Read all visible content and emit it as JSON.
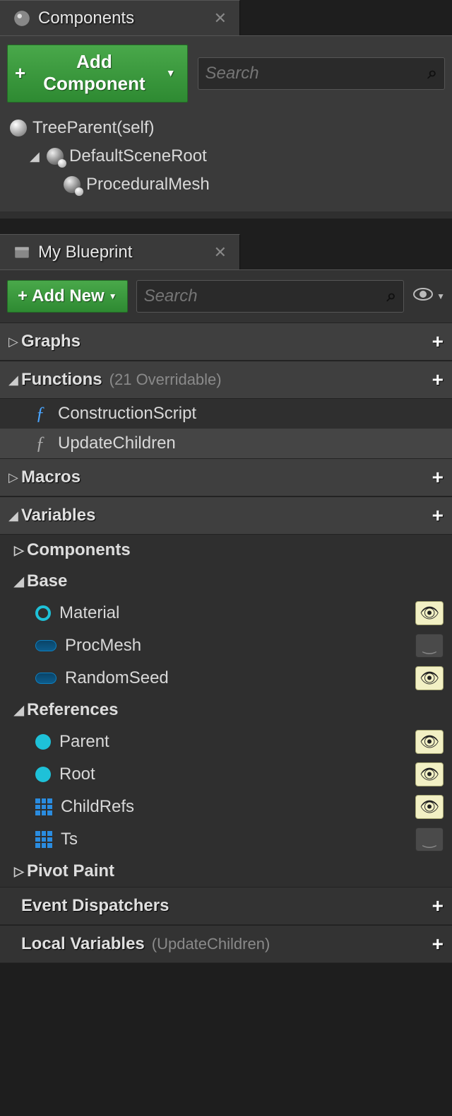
{
  "componentsPanel": {
    "title": "Components",
    "addLabel": "Add Component",
    "searchPlaceholder": "Search",
    "tree": {
      "root": "TreeParent(self)",
      "sceneRoot": "DefaultSceneRoot",
      "child": "ProceduralMesh"
    }
  },
  "blueprintPanel": {
    "title": "My Blueprint",
    "addLabel": "Add New",
    "searchPlaceholder": "Search",
    "sections": {
      "graphs": {
        "label": "Graphs"
      },
      "functions": {
        "label": "Functions",
        "sublabel": "(21 Overridable)",
        "items": [
          "ConstructionScript",
          "UpdateChildren"
        ]
      },
      "macros": {
        "label": "Macros"
      },
      "variables": {
        "label": "Variables",
        "groups": {
          "components": "Components",
          "base": {
            "label": "Base",
            "items": [
              {
                "name": "Material",
                "visible": true,
                "icon": "ring"
              },
              {
                "name": "ProcMesh",
                "visible": false,
                "icon": "pill"
              },
              {
                "name": "RandomSeed",
                "visible": true,
                "icon": "pill"
              }
            ]
          },
          "references": {
            "label": "References",
            "items": [
              {
                "name": "Parent",
                "visible": true,
                "icon": "dot"
              },
              {
                "name": "Root",
                "visible": true,
                "icon": "dot"
              },
              {
                "name": "ChildRefs",
                "visible": true,
                "icon": "grid"
              },
              {
                "name": "Ts",
                "visible": false,
                "icon": "grid"
              }
            ]
          },
          "pivot": "Pivot Paint"
        }
      },
      "dispatchers": {
        "label": "Event Dispatchers"
      },
      "locals": {
        "label": "Local Variables",
        "sublabel": "(UpdateChildren)"
      }
    }
  }
}
